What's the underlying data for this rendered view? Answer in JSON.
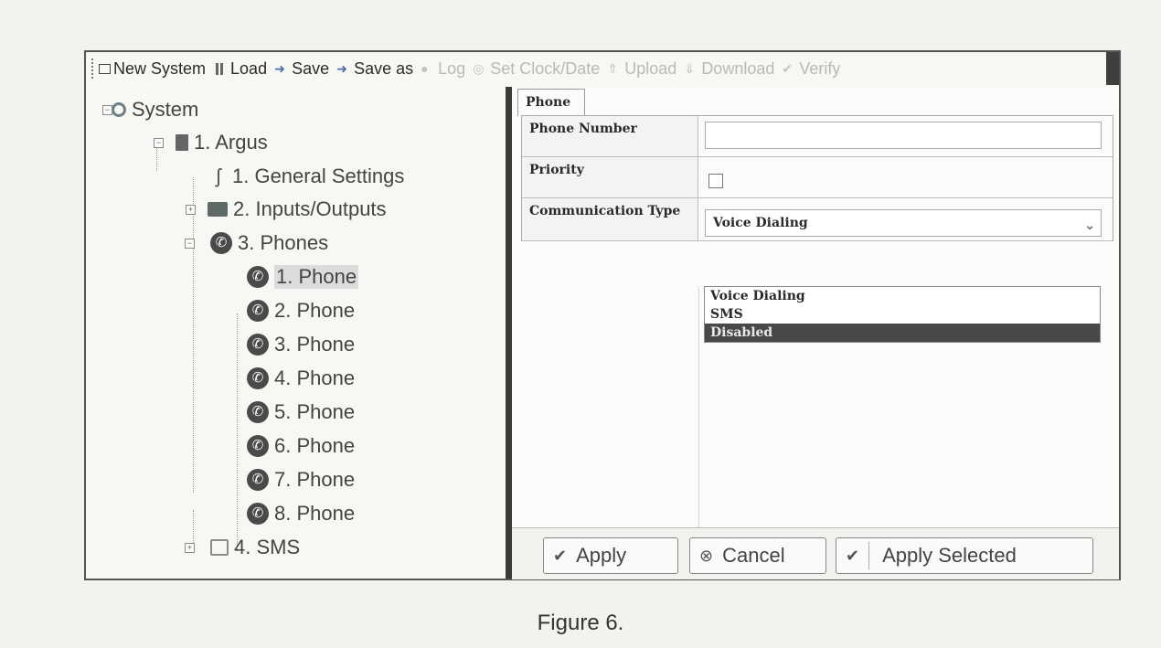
{
  "toolbar": {
    "new_system": "New System",
    "load": "Load",
    "save": "Save",
    "save_as": "Save as",
    "log": "Log",
    "set_clock": "Set Clock/Date",
    "upload": "Upload",
    "download": "Download",
    "verify": "Verify"
  },
  "tree": {
    "system": "System",
    "argus": "1. Argus",
    "general_settings": "1. General Settings",
    "inputs_outputs": "2. Inputs/Outputs",
    "phones": "3. Phones",
    "phone_items": [
      "1. Phone",
      "2. Phone",
      "3. Phone",
      "4. Phone",
      "5. Phone",
      "6. Phone",
      "7. Phone",
      "8. Phone"
    ],
    "sms": "4. SMS"
  },
  "panel": {
    "tab": "Phone",
    "phone_number_label": "Phone Number",
    "phone_number_value": "",
    "priority_label": "Priority",
    "communication_type_label": "Communication Type",
    "communication_type_value": "Voice Dialing",
    "dropdown_options": [
      "Voice Dialing",
      "SMS",
      "Disabled"
    ],
    "highlighted_option": "Disabled"
  },
  "buttons": {
    "apply": "Apply",
    "cancel": "Cancel",
    "apply_selected": "Apply Selected"
  },
  "caption": "Figure 6."
}
